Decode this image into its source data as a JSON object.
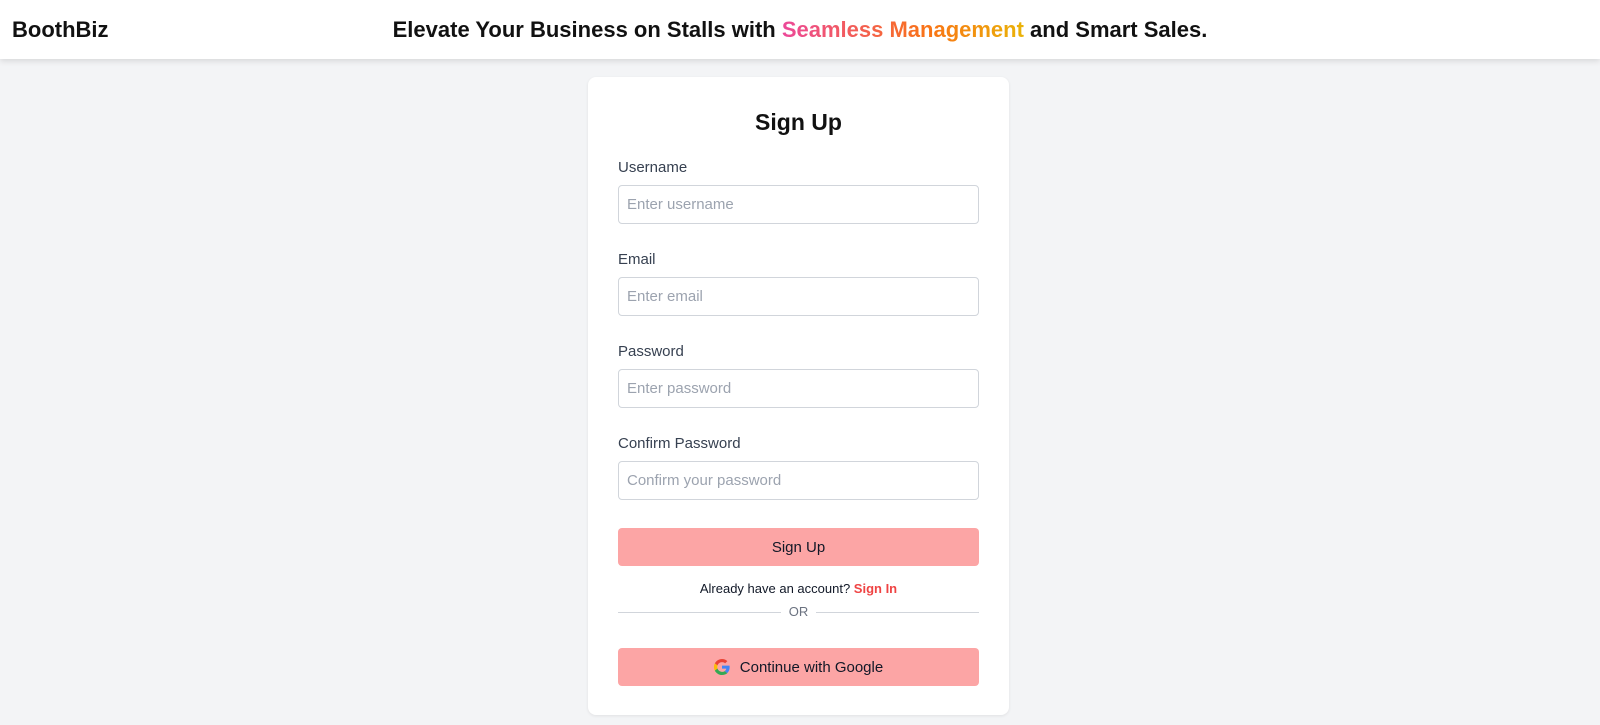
{
  "header": {
    "brand": "BoothBiz",
    "tagline_before": "Elevate Your Business on Stalls with ",
    "tagline_highlight": "Seamless Management",
    "tagline_after": " and Smart Sales."
  },
  "form": {
    "title": "Sign Up",
    "fields": [
      {
        "label": "Username",
        "placeholder": "Enter username",
        "value": ""
      },
      {
        "label": "Email",
        "placeholder": "Enter email",
        "value": ""
      },
      {
        "label": "Password",
        "placeholder": "Enter password",
        "value": ""
      },
      {
        "label": "Confirm Password",
        "placeholder": "Confirm your password",
        "value": ""
      }
    ],
    "submit_label": "Sign Up",
    "signin_prompt": "Already have an account?",
    "signin_link": "Sign In",
    "divider_text": "OR",
    "google_label": "Continue with Google",
    "google_icon": "google-icon"
  },
  "colors": {
    "button_bg": "#fca5a5",
    "link": "#ef4444",
    "page_bg": "#f3f4f6",
    "highlight_gradient": [
      "#ec4899",
      "#f97316",
      "#eab308"
    ]
  }
}
